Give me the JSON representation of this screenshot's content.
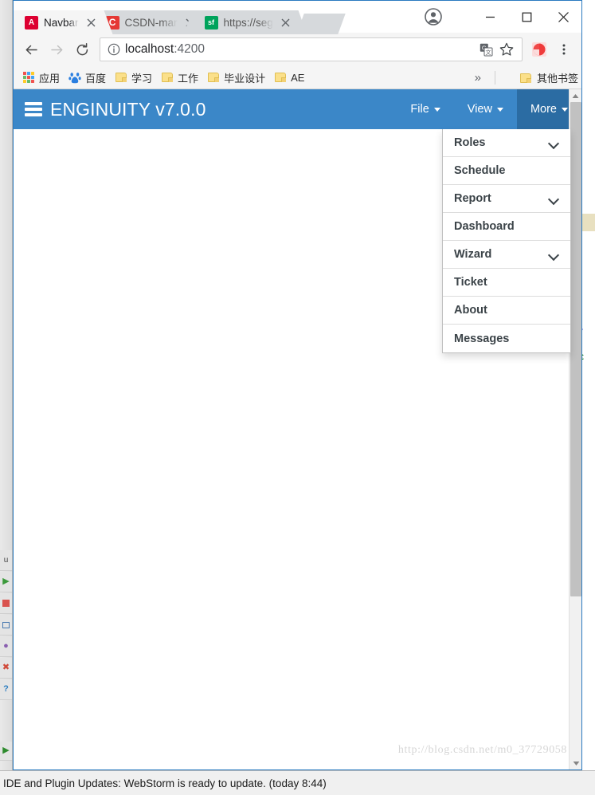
{
  "browser": {
    "window_controls": {
      "minimize": "minimize-icon",
      "maximize": "maximize-icon",
      "close": "close-icon"
    },
    "profile": "profile-avatar-icon",
    "tabs": [
      {
        "title": "Navbar",
        "favicon_label": "A",
        "favicon_color": "#dd0031",
        "active": true
      },
      {
        "title": "CSDN-mar",
        "favicon_label": "C",
        "favicon_color": "#e53935",
        "active": false
      },
      {
        "title": "https://seg",
        "favicon_label": "sf",
        "favicon_color": "#00a35c",
        "active": false
      }
    ],
    "toolbar": {
      "back": "back-arrow-icon",
      "forward": "forward-arrow-icon",
      "reload": "reload-icon",
      "site_info": "info-circle-icon",
      "url_host": "localhost",
      "url_port": ":4200",
      "translate": "translate-icon",
      "bookmark_star": "star-icon",
      "extension": "extension-icon",
      "menu": "three-dot-menu-icon"
    },
    "bookmarks": {
      "items": [
        {
          "label": "应用",
          "icon": "apps-grid-icon"
        },
        {
          "label": "百度",
          "icon": "baidu-icon"
        },
        {
          "label": "学习",
          "icon": "folder-icon"
        },
        {
          "label": "工作",
          "icon": "folder-icon"
        },
        {
          "label": "毕业设计",
          "icon": "folder-icon"
        },
        {
          "label": "AE",
          "icon": "folder-icon"
        }
      ],
      "overflow": "»",
      "other": {
        "label": "其他书签",
        "icon": "folder-icon"
      }
    }
  },
  "app": {
    "navbar_color": "#3b87c8",
    "navbar_active_color": "#2b6ca3",
    "brand": "ENGINUITY v7.0.0",
    "hamburger": "hamburger-icon",
    "nav_items": [
      {
        "label": "File",
        "has_caret": true,
        "active": false
      },
      {
        "label": "View",
        "has_caret": true,
        "active": false
      },
      {
        "label": "More",
        "has_caret": true,
        "active": true
      }
    ],
    "dropdown": {
      "open_for": "More",
      "items": [
        {
          "label": "Roles",
          "has_submenu": true
        },
        {
          "label": "Schedule",
          "has_submenu": false
        },
        {
          "label": "Report",
          "has_submenu": true
        },
        {
          "label": "Dashboard",
          "has_submenu": false
        },
        {
          "label": "Wizard",
          "has_submenu": true
        },
        {
          "label": "Ticket",
          "has_submenu": false
        },
        {
          "label": "About",
          "has_submenu": false
        },
        {
          "label": "Messages",
          "has_submenu": false
        }
      ]
    },
    "watermark": "http://blog.csdn.net/m0_37729058",
    "scrollbar": {
      "up": "scroll-up-arrow-icon",
      "down": "scroll-down-arrow-icon"
    }
  },
  "ide": {
    "statusbar": "IDE and Plugin Updates: WebStorm is ready to update. (today 8:44)",
    "left_rail_icons": [
      "u",
      "run-icon",
      "stop-icon",
      "terminal-icon",
      "debug-icon",
      "close-icon",
      "help-icon"
    ],
    "code_fragments": [
      "]",
      "]",
      "]",
      "/",
      "€"
    ]
  }
}
